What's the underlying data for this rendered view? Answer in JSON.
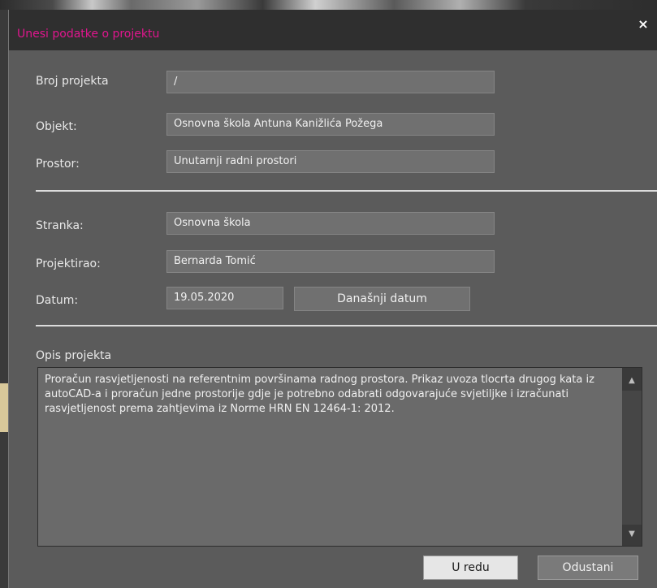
{
  "dialog": {
    "title": "Unesi podatke o projektu",
    "close_glyph": "×"
  },
  "fields": {
    "broj": {
      "label": "Broj projekta",
      "value": "/"
    },
    "objekt": {
      "label": "Objekt:",
      "value": "Osnovna škola Antuna Kanižlića Požega"
    },
    "prostor": {
      "label": "Prostor:",
      "value": "Unutarnji radni prostori"
    },
    "stranka": {
      "label": "Stranka:",
      "value": "Osnovna škola"
    },
    "projektirao": {
      "label": "Projektirao:",
      "value": "Bernarda Tomić"
    },
    "datum": {
      "label": "Datum:",
      "value": "19.05.2020"
    }
  },
  "today_button": "Današnji datum",
  "opis": {
    "label": "Opis projekta",
    "text": "Proračun rasvjetljenosti na referentnim površinama radnog prostora. Prikaz uvoza tlocrta drugog kata iz autoCAD-a i proračun jedne prostorije gdje je potrebno odabrati odgovarajuće svjetiljke i izračunati rasvjetljenost prema zahtjevima iz Norme HRN EN 12464-1: 2012."
  },
  "scroll": {
    "up_glyph": "▲",
    "down_glyph": "▼"
  },
  "buttons": {
    "ok": "U redu",
    "cancel": "Odustani"
  },
  "icons": {
    "close": "close-icon",
    "scroll_up": "arrow-up-icon",
    "scroll_down": "arrow-down-icon"
  },
  "colors": {
    "title": "#e0168e",
    "titlebar": "#2f2f2f",
    "dialog_bg": "#5b5b5b",
    "field_bg": "#707070"
  }
}
